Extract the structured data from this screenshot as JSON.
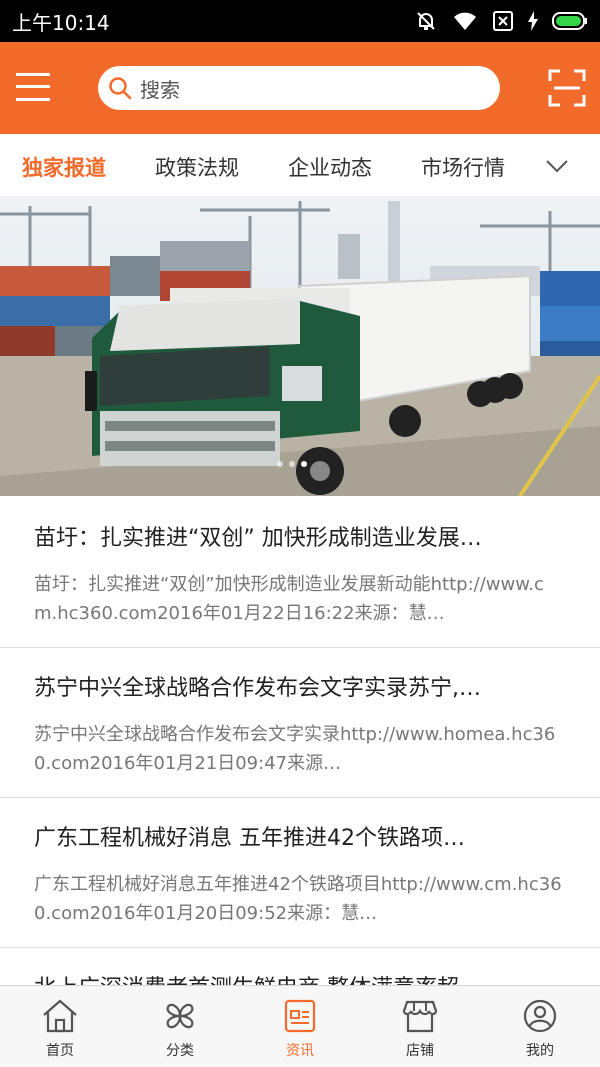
{
  "status_bar": {
    "time": "上午10:14"
  },
  "header": {
    "search_placeholder": "搜索",
    "accent_color": "#f26b2a"
  },
  "tabs": [
    {
      "label": "独家报道",
      "active": true
    },
    {
      "label": "政策法规",
      "active": false
    },
    {
      "label": "企业动态",
      "active": false
    },
    {
      "label": "市场行情",
      "active": false
    }
  ],
  "banner": {
    "subject": "green-white-semi-truck-at-container-port",
    "dot_count": 3,
    "active_dot": 2
  },
  "news": [
    {
      "title": "苗圩：扎实推进“双创” 加快形成制造业发展…",
      "desc": "苗圩：扎实推进“双创”加快形成制造业发展新动能http://www.cm.hc360.com2016年01月22日16:22来源：慧…"
    },
    {
      "title": "苏宁中兴全球战略合作发布会文字实录苏宁,…",
      "desc": "苏宁中兴全球战略合作发布会文字实录http://www.homea.hc360.com2016年01月21日09:47来源…"
    },
    {
      "title": "广东工程机械好消息 五年推进42个铁路项…",
      "desc": "广东工程机械好消息五年推进42个铁路项目http://www.cm.hc360.com2016年01月20日09:52来源：慧…"
    },
    {
      "title": "北上广深消费者首测生鲜电商 整体满意率超…",
      "desc": ""
    }
  ],
  "bottom_nav": [
    {
      "label": "首页",
      "icon": "home-icon",
      "active": false
    },
    {
      "label": "分类",
      "icon": "category-icon",
      "active": false
    },
    {
      "label": "资讯",
      "icon": "news-icon",
      "active": true
    },
    {
      "label": "店铺",
      "icon": "store-icon",
      "active": false
    },
    {
      "label": "我的",
      "icon": "profile-icon",
      "active": false
    }
  ]
}
